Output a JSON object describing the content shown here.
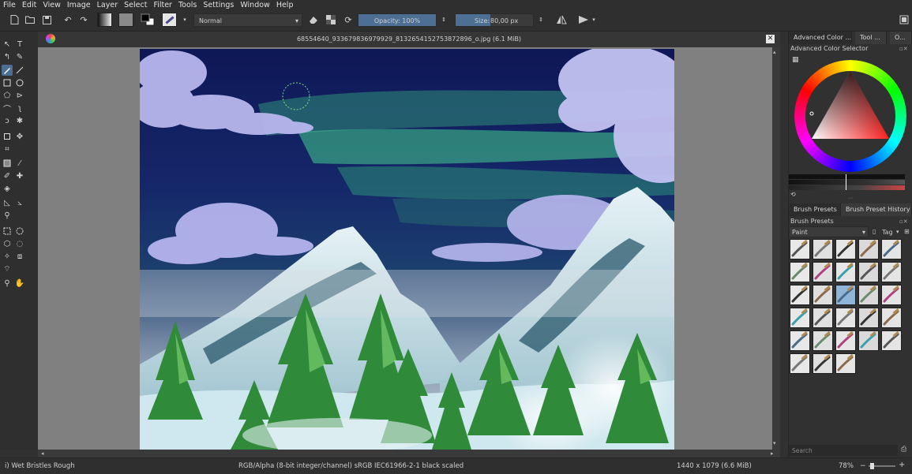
{
  "menu": [
    "File",
    "Edit",
    "View",
    "Image",
    "Layer",
    "Select",
    "Filter",
    "Tools",
    "Settings",
    "Window",
    "Help"
  ],
  "toolbar": {
    "blend_mode": "Normal",
    "opacity_label": "Opacity: 100%",
    "opacity_value": 1.0,
    "size_label": "Size:",
    "size_value": "80,00 px",
    "size_fraction": 0.45
  },
  "document": {
    "title": "68554640_933679836979929_8132654152753872896_o.jpg (6.1 MiB)"
  },
  "right_panel": {
    "tabs": [
      "Advanced Color ...",
      "Tool ...",
      "O..."
    ],
    "color_selector_title": "Advanced Color Selector",
    "preset_tabs": [
      "Brush Presets",
      "Brush Preset History"
    ],
    "presets_title": "Brush Presets",
    "presets_filter": "Paint",
    "tag_label": "Tag",
    "search_placeholder": "Search"
  },
  "status": {
    "brush": "i) Wet Bristles Rough",
    "color_space": "RGB/Alpha (8-bit integer/channel)  sRGB IEC61966-2-1 black scaled",
    "dimensions": "1440 x 1079 (6.6 MiB)",
    "zoom": "78%"
  },
  "colors": {
    "accent": "#4d6f93",
    "sky_top": "#12195a",
    "aurora": "#3fbf8a",
    "cloud": "#b9b8ef",
    "snow": "#cfe7ee",
    "tree": "#2f8a3a"
  }
}
